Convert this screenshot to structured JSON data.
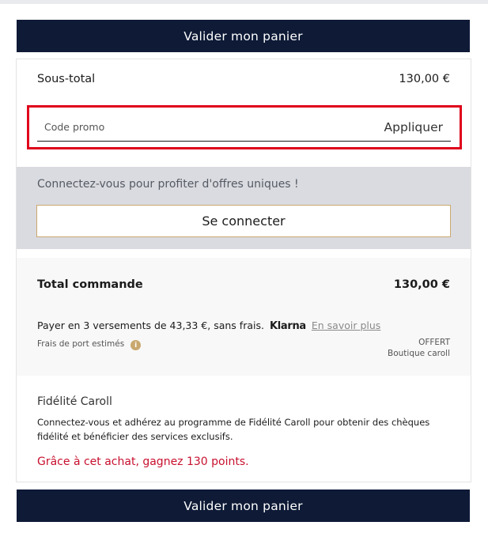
{
  "actions": {
    "validate_label_top": "Valider mon panier",
    "validate_label_bottom": "Valider mon panier"
  },
  "summary": {
    "subtotal_label": "Sous-total",
    "subtotal_value": "130,00 €"
  },
  "promo": {
    "placeholder": "Code promo",
    "apply_label": "Appliquer",
    "highlight_color": "#e0001b"
  },
  "login": {
    "prompt": "Connectez-vous pour profiter d'offres uniques !",
    "button_label": "Se connecter"
  },
  "total": {
    "label": "Total commande",
    "value": "130,00 €"
  },
  "payment": {
    "installments_text": "Payer en 3 versements de 43,33 €, sans frais.",
    "provider": "Klarna",
    "more_link": "En savoir plus"
  },
  "shipping": {
    "label": "Frais de port estimés",
    "value": "OFFERT",
    "method": "Boutique caroll",
    "info_icon": "info-icon"
  },
  "loyalty": {
    "title": "Fidélité Caroll",
    "description": "Connectez-vous et adhérez au programme de Fidélité Caroll pour obtenir des chèques fidélité et bénéficier des services exclusifs.",
    "points_text": "Grâce à cet achat, gagnez 130 points."
  },
  "colors": {
    "primary_navy": "#0e1a36",
    "accent_gold": "#c9a86e",
    "points_red": "#c8102e"
  }
}
